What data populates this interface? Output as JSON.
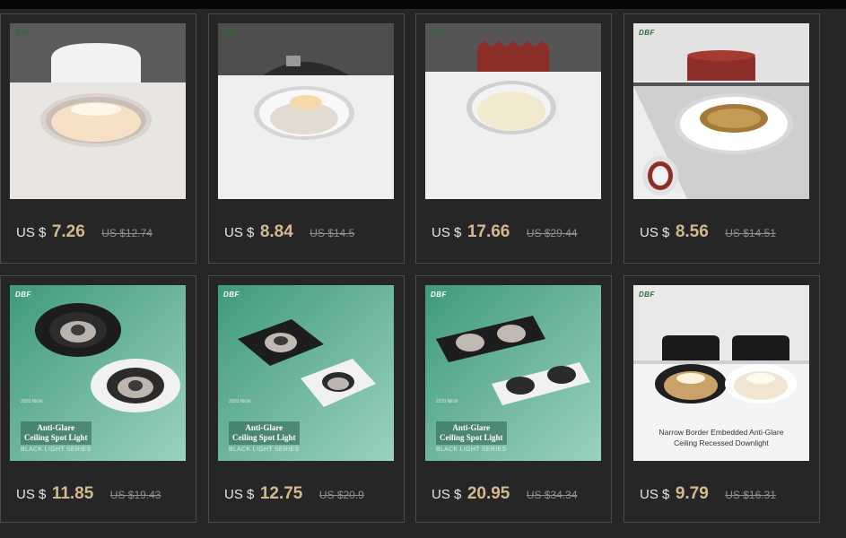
{
  "brand": "DBF",
  "currency": "US $",
  "products": [
    {
      "price": "7.26",
      "old_price": "US $12.74",
      "image": "recessed-downlight-white-warm"
    },
    {
      "price": "8.84",
      "old_price": "US $14.5",
      "image": "adjustable-recessed-spotlight"
    },
    {
      "price": "17.66",
      "old_price": "US $29.44",
      "image": "recessed-downlight-red-heatsink"
    },
    {
      "price": "8.56",
      "old_price": "US $14.51",
      "image": "honeycomb-downlight-red-heatsink"
    },
    {
      "price": "11.85",
      "old_price": "US $19.43",
      "image": "anti-glare-round-spotlights",
      "new_tag": "2020 NEW",
      "caption": [
        "Anti-Glare",
        "Ceiling Spot Light"
      ],
      "series": "BLACK LIGHT SERIES"
    },
    {
      "price": "12.75",
      "old_price": "US $20.9",
      "image": "anti-glare-square-spotlights",
      "new_tag": "2020 NEW",
      "caption": [
        "Anti-Glare",
        "Ceiling Spot Light"
      ],
      "series": "BLACK LIGHT SERIES"
    },
    {
      "price": "20.95",
      "old_price": "US $34.34",
      "image": "anti-glare-double-spotlights",
      "new_tag": "2020 NEW",
      "caption": [
        "Anti-Glare",
        "Ceiling Spot Light"
      ],
      "series": "BLACK LIGHT SERIES"
    },
    {
      "price": "9.79",
      "old_price": "US $16.31",
      "image": "narrow-border-downlights",
      "caption": [
        "Narrow Border Embedded Anti-Glare",
        "Ceiling Recessed Downlight"
      ]
    }
  ]
}
